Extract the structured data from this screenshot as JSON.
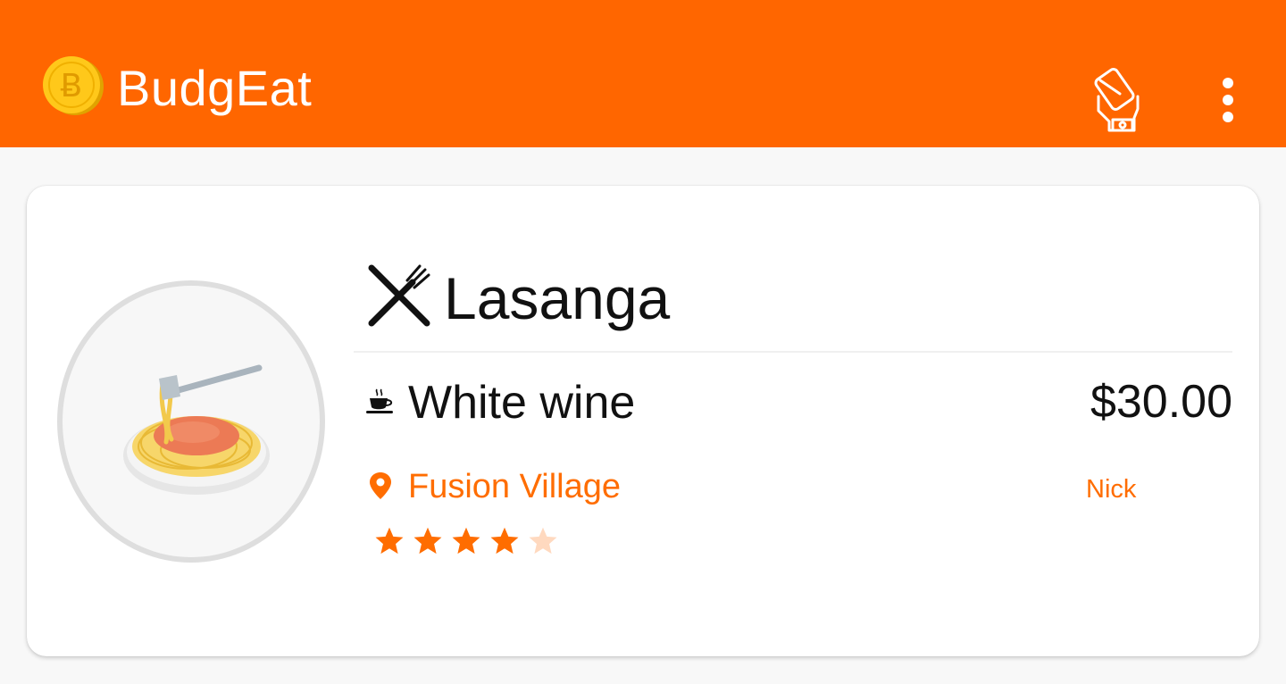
{
  "appbar": {
    "title": "BudgEat",
    "background": "#ff6600",
    "logo_icon": "coin-icon",
    "actions": [
      {
        "icon": "wallet-hand-icon"
      },
      {
        "icon": "more-vert-icon"
      }
    ]
  },
  "meal_card": {
    "dish": {
      "icon": "cutlery-icon",
      "name": "Lasanga"
    },
    "drink": {
      "icon": "cup-icon",
      "name": "White wine"
    },
    "price": "$30.00",
    "place": {
      "icon": "location-pin-icon",
      "name": "Fusion Village"
    },
    "author": "Nick",
    "rating": 4,
    "rating_max": 5,
    "image_icon": "spaghetti-icon",
    "accent_color": "#ff6d00"
  }
}
